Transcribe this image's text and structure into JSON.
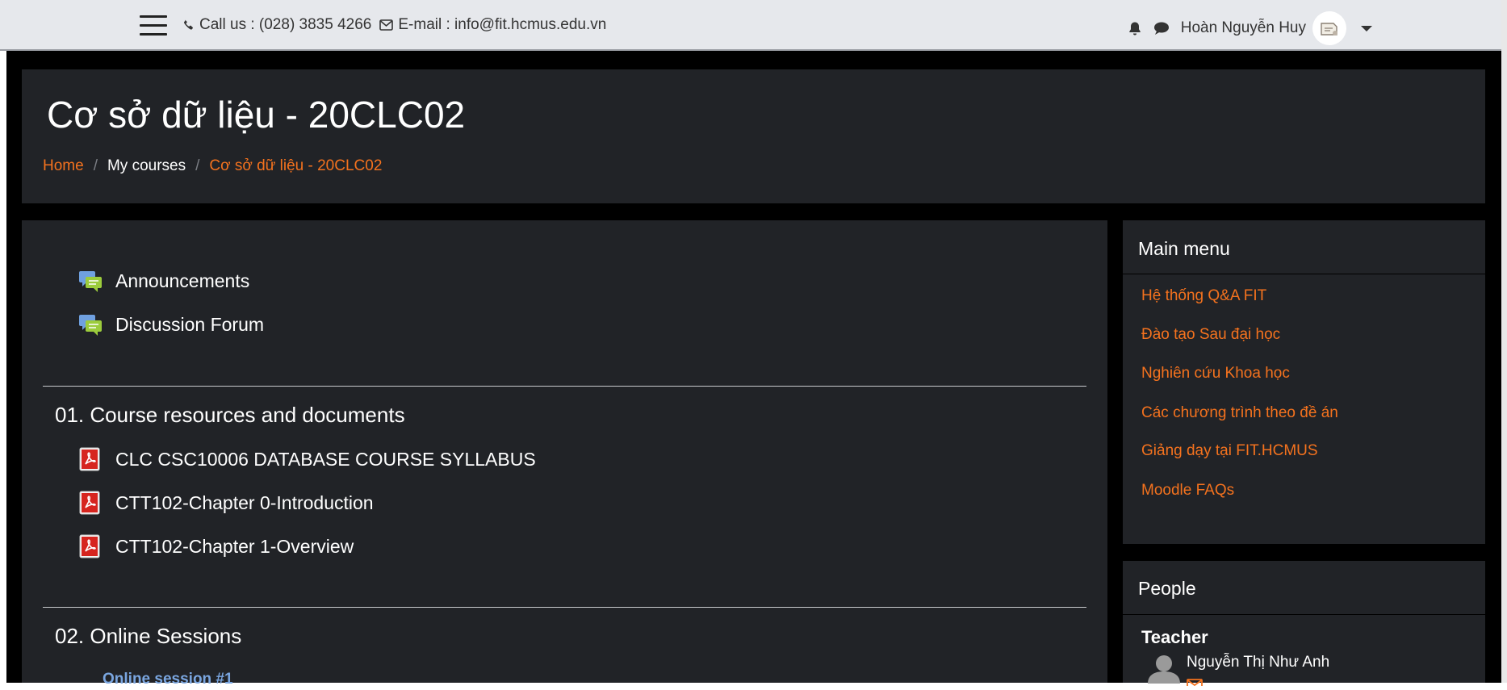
{
  "topbar": {
    "phone_text": "Call us : (028) 3835 4266",
    "email_text": "E-mail : info@fit.hcmus.edu.vn",
    "user_name": "Hoàn Nguyễn Huy"
  },
  "header": {
    "title": "Cơ sở dữ liệu - 20CLC02",
    "breadcrumb": [
      {
        "label": "Home"
      },
      {
        "label": "My courses"
      },
      {
        "label": "Cơ sở dữ liệu - 20CLC02"
      }
    ]
  },
  "main": {
    "top_activities": [
      {
        "label": "Announcements",
        "icon": "forum-icon"
      },
      {
        "label": "Discussion Forum",
        "icon": "forum-icon"
      }
    ],
    "sections": [
      {
        "title": "01. Course resources and documents",
        "items": [
          {
            "label": "CLC CSC10006 DATABASE COURSE SYLLABUS",
            "icon": "pdf-icon"
          },
          {
            "label": "CTT102-Chapter 0-Introduction",
            "icon": "pdf-icon"
          },
          {
            "label": "CTT102-Chapter 1-Overview",
            "icon": "pdf-icon"
          }
        ]
      },
      {
        "title": "02. Online Sessions",
        "subsection": "Online session #1"
      }
    ]
  },
  "sidebar": {
    "main_menu": {
      "title": "Main menu",
      "items": [
        {
          "label": "Hệ thống Q&A FIT"
        },
        {
          "label": "Đào tạo Sau đại học"
        },
        {
          "label": "Nghiên cứu Khoa học"
        },
        {
          "label": "Các chương trình theo đề án"
        },
        {
          "label": "Giảng dạy tại FIT.HCMUS"
        },
        {
          "label": "Moodle FAQs"
        }
      ]
    },
    "people": {
      "title": "People",
      "role": "Teacher",
      "teacher_name": "Nguyễn Thị Như Anh"
    }
  },
  "colors": {
    "accent": "#f4721e",
    "card_bg": "#212327",
    "page_bg": "#000000",
    "topbar_bg": "#e6e8ec",
    "link_blue": "#7aa6e0"
  }
}
